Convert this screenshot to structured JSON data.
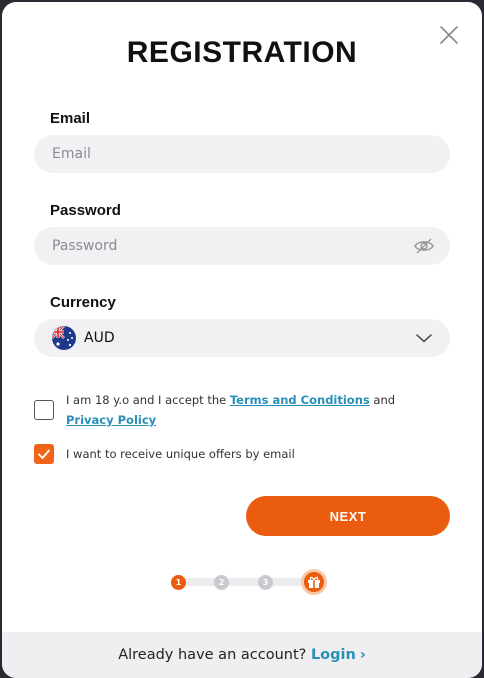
{
  "title": "REGISTRATION",
  "email": {
    "label": "Email",
    "placeholder": "Email"
  },
  "password": {
    "label": "Password",
    "placeholder": "Password"
  },
  "currency": {
    "label": "Currency",
    "selected": "AUD",
    "flag_icon": "australia-flag-icon"
  },
  "terms": {
    "checked": false,
    "prefix": "I am 18 y.o and I accept the ",
    "terms_link": "Terms and Conditions",
    "middle": " and ",
    "privacy_link": "Privacy Policy"
  },
  "offers": {
    "checked": true,
    "text": "I want to receive unique offers by email"
  },
  "next_label": "NEXT",
  "steps": {
    "labels": [
      "1",
      "2",
      "3"
    ],
    "current": 1,
    "final_icon": "gift-icon"
  },
  "footer": {
    "prompt": "Already have an account?",
    "login_label": "Login",
    "arrow": "›"
  },
  "colors": {
    "accent": "#ea5c10",
    "link": "#2a8fb8",
    "field_bg": "#f1f1f3"
  }
}
